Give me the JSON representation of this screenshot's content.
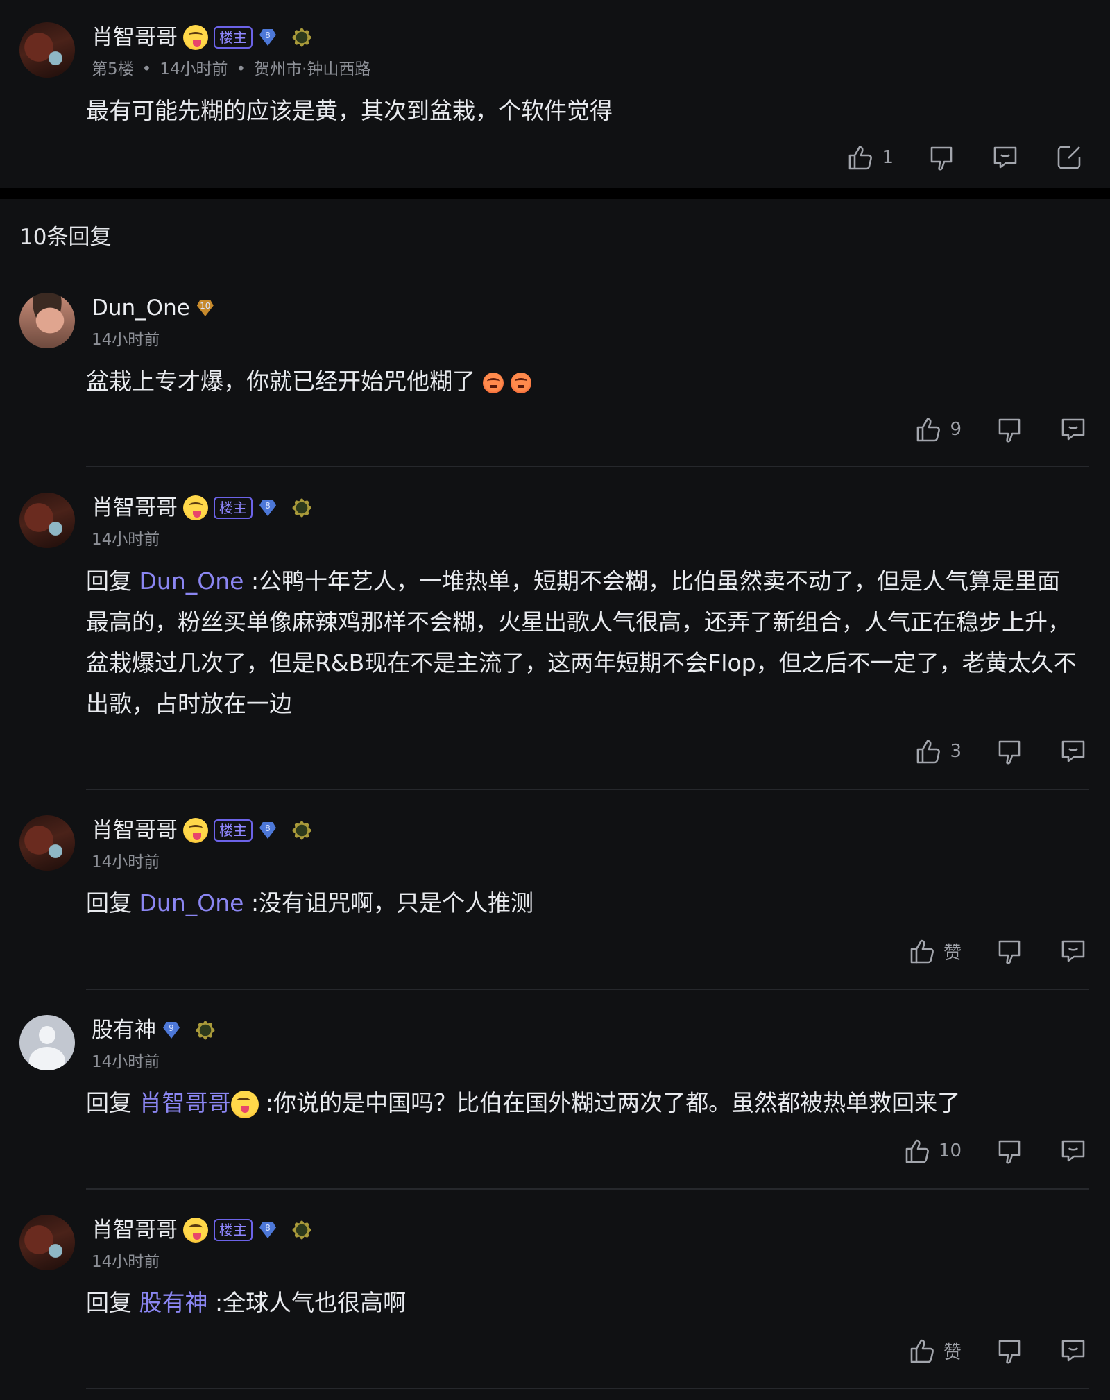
{
  "op": {
    "username": "肖智哥哥",
    "owner_tag": "楼主",
    "level": "8",
    "floor": "第5楼",
    "time": "14小时前",
    "location": "贺州市·钟山西路",
    "content": "最有可能先糊的应该是黄，其次到盆栽，个软件觉得",
    "likes": "1"
  },
  "replies_count": "10条回复",
  "replies": [
    {
      "username": "Dun_One",
      "level": "10",
      "time": "14小时前",
      "content": "盆栽上专才爆，你就已经开始咒他糊了",
      "likes": "9"
    },
    {
      "username": "肖智哥哥",
      "owner_tag": "楼主",
      "level": "8",
      "time": "14小时前",
      "reply_prefix": "回复",
      "reply_to": "Dun_One",
      "content": ":公鸭十年艺人，一堆热单，短期不会糊，比伯虽然卖不动了，但是人气算是里面最高的，粉丝买单像麻辣鸡那样不会糊，火星出歌人气很高，还弄了新组合，人气正在稳步上升，盆栽爆过几次了，但是R&B现在不是主流了，这两年短期不会Flop，但之后不一定了，老黄太久不出歌，占时放在一边",
      "likes": "3"
    },
    {
      "username": "肖智哥哥",
      "owner_tag": "楼主",
      "level": "8",
      "time": "14小时前",
      "reply_prefix": "回复",
      "reply_to": "Dun_One",
      "content": ":没有诅咒啊，只是个人推测",
      "likes": "赞"
    },
    {
      "username": "股有神",
      "level": "9",
      "time": "14小时前",
      "reply_prefix": "回复",
      "reply_to": "肖智哥哥",
      "content": ":你说的是中国吗？比伯在国外糊过两次了都。虽然都被热单救回来了",
      "likes": "10"
    },
    {
      "username": "肖智哥哥",
      "owner_tag": "楼主",
      "level": "8",
      "time": "14小时前",
      "reply_prefix": "回复",
      "reply_to": "股有神",
      "content": ":全球人气也很高啊",
      "likes": "赞"
    }
  ],
  "icons": {
    "like": "thumbs-up-icon",
    "dislike": "thumbs-down-icon",
    "reply": "comment-icon",
    "share": "share-icon"
  },
  "colors": {
    "background": "#101113",
    "mention": "#8b86f2",
    "owner_tag": "#6c63e8",
    "muted": "#8d9097"
  }
}
